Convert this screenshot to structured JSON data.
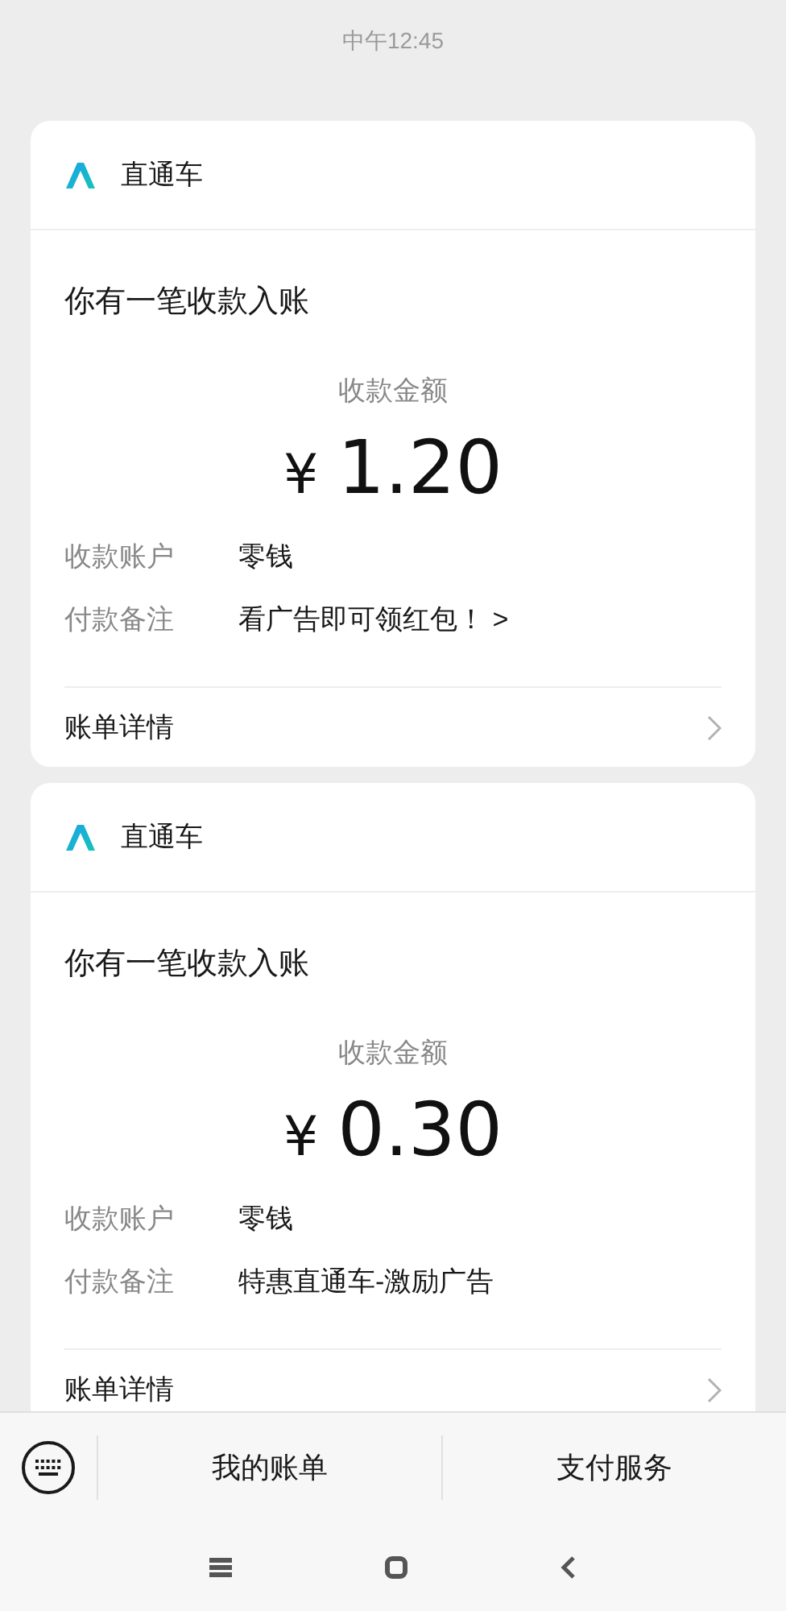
{
  "time": "中午12:45",
  "messages": [
    {
      "app_name": "直通车",
      "title": "你有一笔收款入账",
      "amount_label": "收款金额",
      "currency": "¥",
      "amount": "1.20",
      "fields": [
        {
          "label": "收款账户",
          "value": "零钱"
        },
        {
          "label": "付款备注",
          "value": "看广告即可领红包！ >"
        }
      ],
      "footer": "账单详情"
    },
    {
      "app_name": "直通车",
      "title": "你有一笔收款入账",
      "amount_label": "收款金额",
      "currency": "¥",
      "amount": "0.30",
      "fields": [
        {
          "label": "收款账户",
          "value": "零钱"
        },
        {
          "label": "付款备注",
          "value": "特惠直通车-激励广告"
        }
      ],
      "footer": "账单详情"
    }
  ],
  "bottom_menu": [
    "我的账单",
    "支付服务"
  ]
}
